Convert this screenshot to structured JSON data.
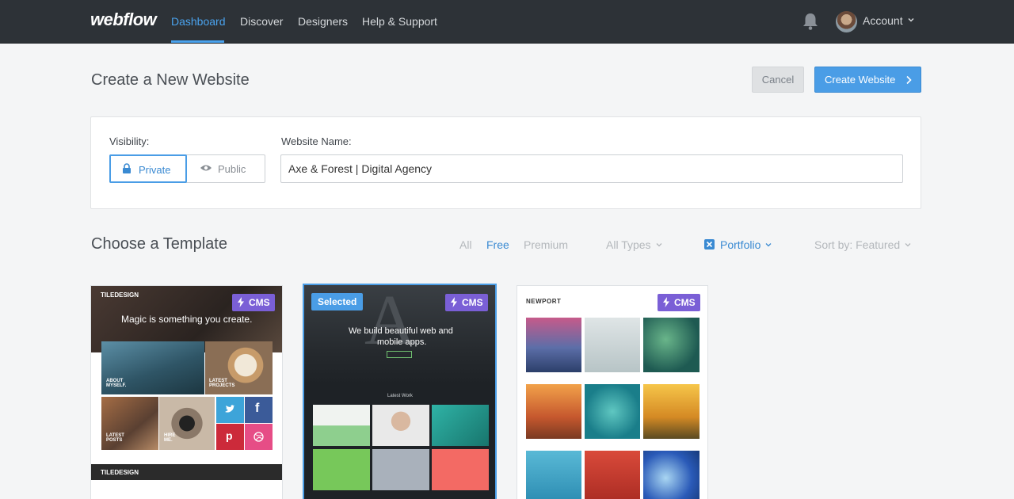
{
  "nav": {
    "logo": "webflow",
    "links": [
      "Dashboard",
      "Discover",
      "Designers",
      "Help & Support"
    ],
    "active_link": "Dashboard",
    "account_label": "Account",
    "accent": "#4aa3ee"
  },
  "header": {
    "title": "Create a New Website",
    "cancel_label": "Cancel",
    "create_label": "Create Website"
  },
  "settings": {
    "visibility_label": "Visibility:",
    "private_label": "Private",
    "public_label": "Public",
    "selected_visibility": "Private",
    "name_label": "Website Name:",
    "name_value": "Axe & Forest | Digital Agency"
  },
  "templates": {
    "title": "Choose a Template",
    "filters": {
      "all": "All",
      "free": "Free",
      "premium": "Premium",
      "types": "All Types",
      "portfolio": "Portfolio",
      "sort": "Sort by: Featured"
    },
    "active_filter": "Free",
    "cards": [
      {
        "brand": "TILEDESIGN",
        "badge": "CMS",
        "hero": "Magic is something you create.",
        "tile1": "ABOUT MYSELF.",
        "tile2": "LATEST PROJECTS",
        "tile3": "LATEST POSTS",
        "tile4": "HIRE ME."
      },
      {
        "selected_label": "Selected",
        "badge": "CMS",
        "hero_line1": "We build beautiful web and",
        "hero_line2": "mobile apps.",
        "section": "Latest Work"
      },
      {
        "brand": "NEWPORT",
        "badge": "CMS"
      }
    ]
  }
}
